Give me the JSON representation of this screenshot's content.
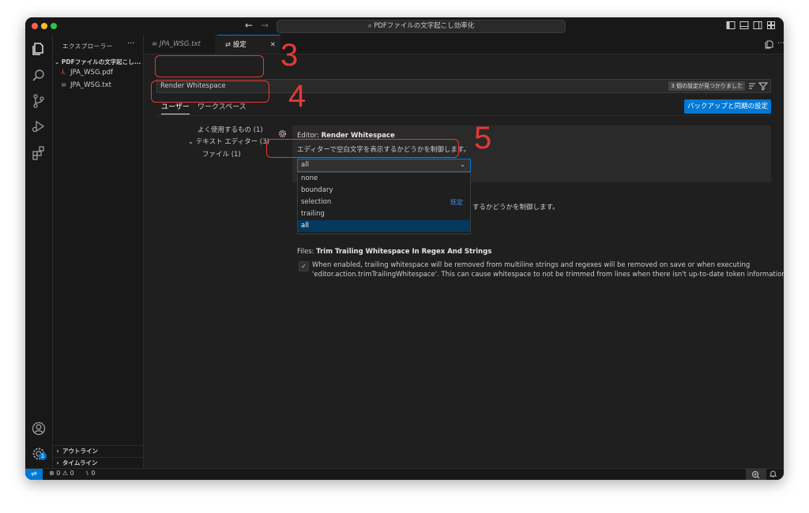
{
  "window": {
    "command_center": "PDFファイルの文字起こし効率化"
  },
  "sidebar": {
    "title": "エクスプローラー",
    "more": "···",
    "folder": "PDFファイルの文字起こし...",
    "files": [
      {
        "name": "JPA_WSG.pdf",
        "icon": "pdf-icon"
      },
      {
        "name": "JPA_WSG.txt",
        "icon": "text-file-icon"
      }
    ],
    "outline": "アウトライン",
    "timeline": "タイムライン"
  },
  "activity_badge": "1",
  "tabs": [
    {
      "label": "JPA_WSG.txt"
    },
    {
      "label": "設定",
      "close": "✕"
    }
  ],
  "settings": {
    "search_value": "Render Whitespace",
    "found_badge": "3 個の設定が見つかりました",
    "scopes": [
      "ユーザー",
      "ワークスペース"
    ],
    "sync_button": "バックアップと同期の設定",
    "toc": [
      {
        "label": "よく使用するもの (1)"
      },
      {
        "label": "テキスト エディター (3)"
      },
      {
        "label": "ファイル (1)"
      }
    ],
    "render_whitespace": {
      "category": "Editor: ",
      "name": "Render Whitespace",
      "description": "エディターで空白文字を表示するかどうかを制御します。",
      "value": "all",
      "options": [
        "none",
        "boundary",
        "selection",
        "trailing",
        "all"
      ],
      "default_label": "既定"
    },
    "hidden_desc_tail": "するかどうかを制御します。",
    "trim_trailing": {
      "category": "Files: ",
      "name": "Trim Trailing Whitespace In Regex And Strings",
      "description_line1": "When enabled, trailing whitespace will be removed from multiline strings and regexes will be removed on save or when executing",
      "description_line2": "'editor.action.trimTrailingWhitespace'. This can cause whitespace to not be trimmed from lines when there isn't up-to-date token information.",
      "checked": true,
      "check": "✓"
    }
  },
  "annotations": [
    "3",
    "4",
    "5"
  ],
  "statusbar": {
    "problems": "⊗ 0 ⚠ 0",
    "ports": "⑊ 0"
  },
  "colors": {
    "accent": "#0078d4",
    "annotation": "#e53935"
  }
}
